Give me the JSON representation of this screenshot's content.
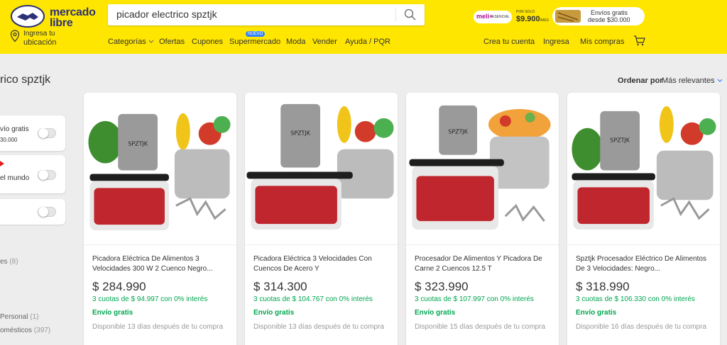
{
  "header": {
    "logo_text_line1": "mercado",
    "logo_text_line2": "libre",
    "search": {
      "value": "picador electrico spztjk"
    },
    "location": {
      "line1": "Ingresa tu",
      "line2": "ubicación"
    },
    "nav": {
      "categorias": "Categorías",
      "ofertas": "Ofertas",
      "cupones": "Cupones",
      "supermercado": "Supermercado",
      "supermercado_badge": "NUEVO",
      "moda": "Moda",
      "vender": "Vender",
      "ayuda": "Ayuda / PQR"
    },
    "promo": {
      "brand": "meli+",
      "brand_sub": "ESENCIAL",
      "por_solo": "POR SOLO",
      "price": "$9.900",
      "per": "/MES",
      "envios_line1": "Envíos gratis",
      "envios_line2": "desde $30.000"
    },
    "user": {
      "crea_cuenta": "Crea tu cuenta",
      "ingresa": "Ingresa",
      "mis_compras": "Mis compras"
    }
  },
  "main": {
    "title": "rico spztjk",
    "sort_label": "Ordenar por",
    "sort_value": "Más relevantes"
  },
  "filters": [
    {
      "line1": "vío gratis",
      "line2": "30.000"
    },
    {
      "line1": "el mundo",
      "line2": ""
    },
    {
      "line1": "",
      "line2": ""
    }
  ],
  "side": {
    "item1": "es",
    "item1_count": "(8)",
    "item2": "Personal",
    "item2_count": "(1)",
    "item3": "omésticos",
    "item3_count": "(397)"
  },
  "products": [
    {
      "title": "Picadora Eléctrica De Alimentos 3 Velocidades 300 W 2 Cuenco Negro...",
      "price": "$ 284.990",
      "installments": "3 cuotas de $ 94.997 con 0% interés",
      "shipping": "Envío gratis",
      "delivery": "Disponible 13 días después de tu compra"
    },
    {
      "title": "Picadora Eléctrica 3 Velocidades Con Cuencos De Acero Y",
      "price": "$ 314.300",
      "installments": "3 cuotas de $ 104.767 con 0% interés",
      "shipping": "Envío gratis",
      "delivery": "Disponible 13 días después de tu compra"
    },
    {
      "title": "Procesador De Alimentos Y Picadora De Carne 2 Cuencos 12.5 T",
      "price": "$ 323.990",
      "installments": "3 cuotas de $ 107.997 con 0% interés",
      "shipping": "Envío gratis",
      "delivery": "Disponible 15 días después de tu compra"
    },
    {
      "title": "Spztjk Procesador Eléctrico De Alimentos De 3 Velocidades: Negro...",
      "price": "$ 318.990",
      "installments": "3 cuotas de $ 106.330 con 0% interés",
      "shipping": "Envío gratis",
      "delivery": "Disponible 16 días después de tu compra"
    }
  ],
  "product_brand_label": "SPZTJK",
  "colors": {
    "header_bg": "#ffe600",
    "price_green": "#00a650",
    "link_blue": "#3483fa"
  }
}
